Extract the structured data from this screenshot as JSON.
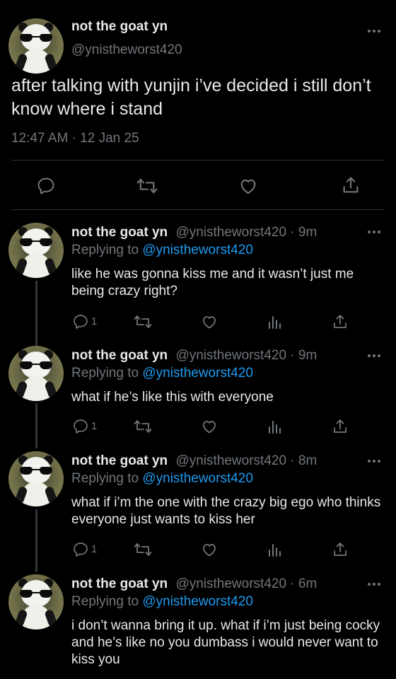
{
  "main_tweet": {
    "display_name": "not the goat yn",
    "handle": "@ynistheworst420",
    "text": "after talking with yunjin i’ve decided i still don’t know where i stand",
    "timestamp": "12:47 AM · 12 Jan 25",
    "actions": [
      "reply-icon",
      "retweet-icon",
      "like-icon",
      "share-icon"
    ]
  },
  "replies": [
    {
      "display_name": "not the goat yn",
      "handle_time": "@ynistheworst420 · 9m",
      "replying_prefix": "Replying to",
      "replying_handle": "@ynistheworst420",
      "text": "like he was gonna kiss me and it wasn’t just me being crazy right?",
      "reply_count": "1"
    },
    {
      "display_name": "not the goat yn",
      "handle_time": "@ynistheworst420 · 9m",
      "replying_prefix": "Replying to",
      "replying_handle": "@ynistheworst420",
      "text": "what if he’s like this with everyone",
      "reply_count": "1"
    },
    {
      "display_name": "not the goat yn",
      "handle_time": "@ynistheworst420 · 8m",
      "replying_prefix": "Replying to",
      "replying_handle": "@ynistheworst420",
      "text": "what if i’m the one with the crazy big ego who thinks everyone just wants to kiss her",
      "reply_count": "1"
    },
    {
      "display_name": "not the goat yn",
      "handle_time": "@ynistheworst420 · 6m",
      "replying_prefix": "Replying to",
      "replying_handle": "@ynistheworst420",
      "text": "i don’t wanna bring it up. what if i’m just being cocky and he’s like no you dumbass i would never want to kiss you",
      "reply_count": ""
    }
  ],
  "colors": {
    "background": "#000000",
    "text": "#e7e9ea",
    "muted": "#71767b",
    "link": "#1d9bf0",
    "divider": "#2f3336"
  }
}
